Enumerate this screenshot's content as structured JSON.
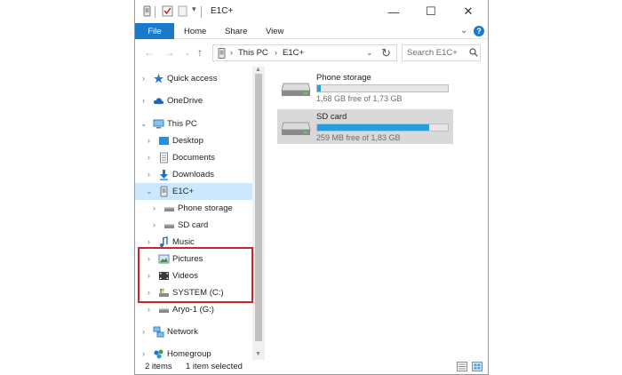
{
  "window": {
    "title": "E1C+",
    "controls": {
      "minimize": "—",
      "maximize": "☐",
      "close": "✕"
    }
  },
  "ribbon": {
    "tabs": [
      "File",
      "Home",
      "Share",
      "View"
    ],
    "expand_glyph": "⌄",
    "help_glyph": "?"
  },
  "address_bar": {
    "back": "←",
    "forward": "→",
    "recent": "⌄",
    "up": "↑",
    "crumbs": [
      "This PC",
      "E1C+"
    ],
    "separator": "›",
    "dropdown": "⌄",
    "refresh": "↻",
    "search_placeholder": "Search E1C+"
  },
  "nav_tree": [
    {
      "label": "Quick access",
      "icon": "star-icon",
      "chevron": "›"
    },
    {
      "label": "OneDrive",
      "icon": "cloud-icon",
      "chevron": "›"
    },
    {
      "label": "This PC",
      "icon": "computer-icon",
      "chevron": "⌄"
    },
    {
      "label": "Desktop",
      "icon": "desktop-folder-icon",
      "chevron": "›"
    },
    {
      "label": "Documents",
      "icon": "documents-folder-icon",
      "chevron": "›"
    },
    {
      "label": "Downloads",
      "icon": "downloads-folder-icon",
      "chevron": "›"
    },
    {
      "label": "E1C+",
      "icon": "phone-device-icon",
      "chevron": "⌄",
      "selected": true
    },
    {
      "label": "Phone storage",
      "icon": "drive-icon",
      "chevron": "›"
    },
    {
      "label": "SD card",
      "icon": "drive-icon",
      "chevron": "›"
    },
    {
      "label": "Music",
      "icon": "music-folder-icon",
      "chevron": "›"
    },
    {
      "label": "Pictures",
      "icon": "pictures-folder-icon",
      "chevron": "›"
    },
    {
      "label": "Videos",
      "icon": "videos-folder-icon",
      "chevron": "›"
    },
    {
      "label": "SYSTEM (C:)",
      "icon": "system-drive-icon",
      "chevron": "›"
    },
    {
      "label": "Aryo-1 (G:)",
      "icon": "usb-drive-icon",
      "chevron": "›"
    },
    {
      "label": "Network",
      "icon": "network-icon",
      "chevron": "›"
    },
    {
      "label": "Homegroup",
      "icon": "homegroup-icon",
      "chevron": "›"
    }
  ],
  "drives": [
    {
      "name": "Phone storage",
      "free_text": "1,68 GB free of 1,73 GB",
      "used_fraction": 0.03,
      "selected": false
    },
    {
      "name": "SD card",
      "free_text": "259 MB free of 1,83 GB",
      "used_fraction": 0.86,
      "selected": true
    }
  ],
  "status_bar": {
    "item_count": "2 items",
    "selection": "1 item selected"
  },
  "colors": {
    "accent": "#1979ca",
    "selection": "#cce8ff",
    "drive_fill": "#26a0da",
    "highlight_box": "#d0232b"
  }
}
